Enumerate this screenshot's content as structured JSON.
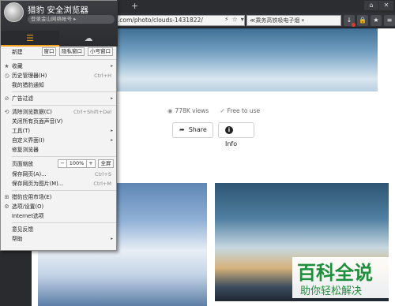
{
  "tabbar": {
    "new_tab": "+",
    "window_buttons": [
      "⌂",
      "✕"
    ]
  },
  "navbar": {
    "url": "s.com/photo/clouds-1431822/",
    "url_icons": [
      "⚡",
      "☆",
      "▾",
      "|",
      "↻"
    ],
    "search_text": "≪乘务高铁吸电子烟",
    "search_dropdown": "▾",
    "toolbar_icons": [
      "↓",
      "🔒",
      "★",
      "≡"
    ]
  },
  "page": {
    "views": "778K views",
    "license": "Free to use",
    "share_label": "Share",
    "info_label": "Info"
  },
  "menu": {
    "brand": "猎豹 安全浏览器",
    "account_prompt": "登录金山网络帐号 ▸",
    "tab_cloud_icon": "☁",
    "tab_menu_icon": "☰",
    "new_label": "新建",
    "new_buttons": [
      "窗口",
      "隐私窗口",
      "小号窗口"
    ],
    "items_a": [
      {
        "label": "收藏",
        "icon": "★",
        "shortcut": "",
        "arrow": "▸"
      },
      {
        "label": "历史管理器(H)",
        "icon": "◷",
        "shortcut": "Ctrl+H",
        "arrow": ""
      },
      {
        "label": "我的猎豹通知",
        "icon": "",
        "shortcut": "",
        "arrow": ""
      }
    ],
    "items_b": [
      {
        "label": "广告过滤",
        "icon": "⊘",
        "shortcut": "",
        "arrow": "▸"
      }
    ],
    "items_c": [
      {
        "label": "清除浏览数据(C)",
        "icon": "⟲",
        "shortcut": "Ctrl+Shift+Del",
        "arrow": ""
      },
      {
        "label": "关闭所有页面声音(V)",
        "icon": "",
        "shortcut": "",
        "arrow": ""
      },
      {
        "label": "工具(T)",
        "icon": "",
        "shortcut": "",
        "arrow": "▸"
      },
      {
        "label": "自定义界面(I)",
        "icon": "",
        "shortcut": "",
        "arrow": "▸"
      },
      {
        "label": "修复浏览器",
        "icon": "",
        "shortcut": "",
        "arrow": ""
      }
    ],
    "zoom_label": "页面缩放",
    "zoom_minus": "−",
    "zoom_value": "100%",
    "zoom_plus": "+",
    "fullscreen": "全屏",
    "items_d": [
      {
        "label": "保存网页(A)...",
        "icon": "",
        "shortcut": "Ctrl+S",
        "arrow": ""
      },
      {
        "label": "保存网页为图片(M)...",
        "icon": "",
        "shortcut": "Ctrl+M",
        "arrow": ""
      }
    ],
    "items_e": [
      {
        "label": "猎豹应用市场(E)",
        "icon": "⊞",
        "shortcut": "",
        "arrow": ""
      },
      {
        "label": "选项/设置(O)",
        "icon": "⚙",
        "shortcut": "",
        "arrow": ""
      },
      {
        "label": "Internet选项",
        "icon": "",
        "shortcut": "",
        "arrow": ""
      }
    ],
    "items_f": [
      {
        "label": "意见反馈",
        "icon": "",
        "shortcut": "",
        "arrow": ""
      },
      {
        "label": "帮助",
        "icon": "",
        "shortcut": "",
        "arrow": "▸"
      }
    ]
  },
  "watermark": {
    "title": "百科全说",
    "subtitle": "助你轻松解决"
  },
  "colors": {
    "accent": "#f0a020",
    "watermark": "#1e8f3c"
  }
}
